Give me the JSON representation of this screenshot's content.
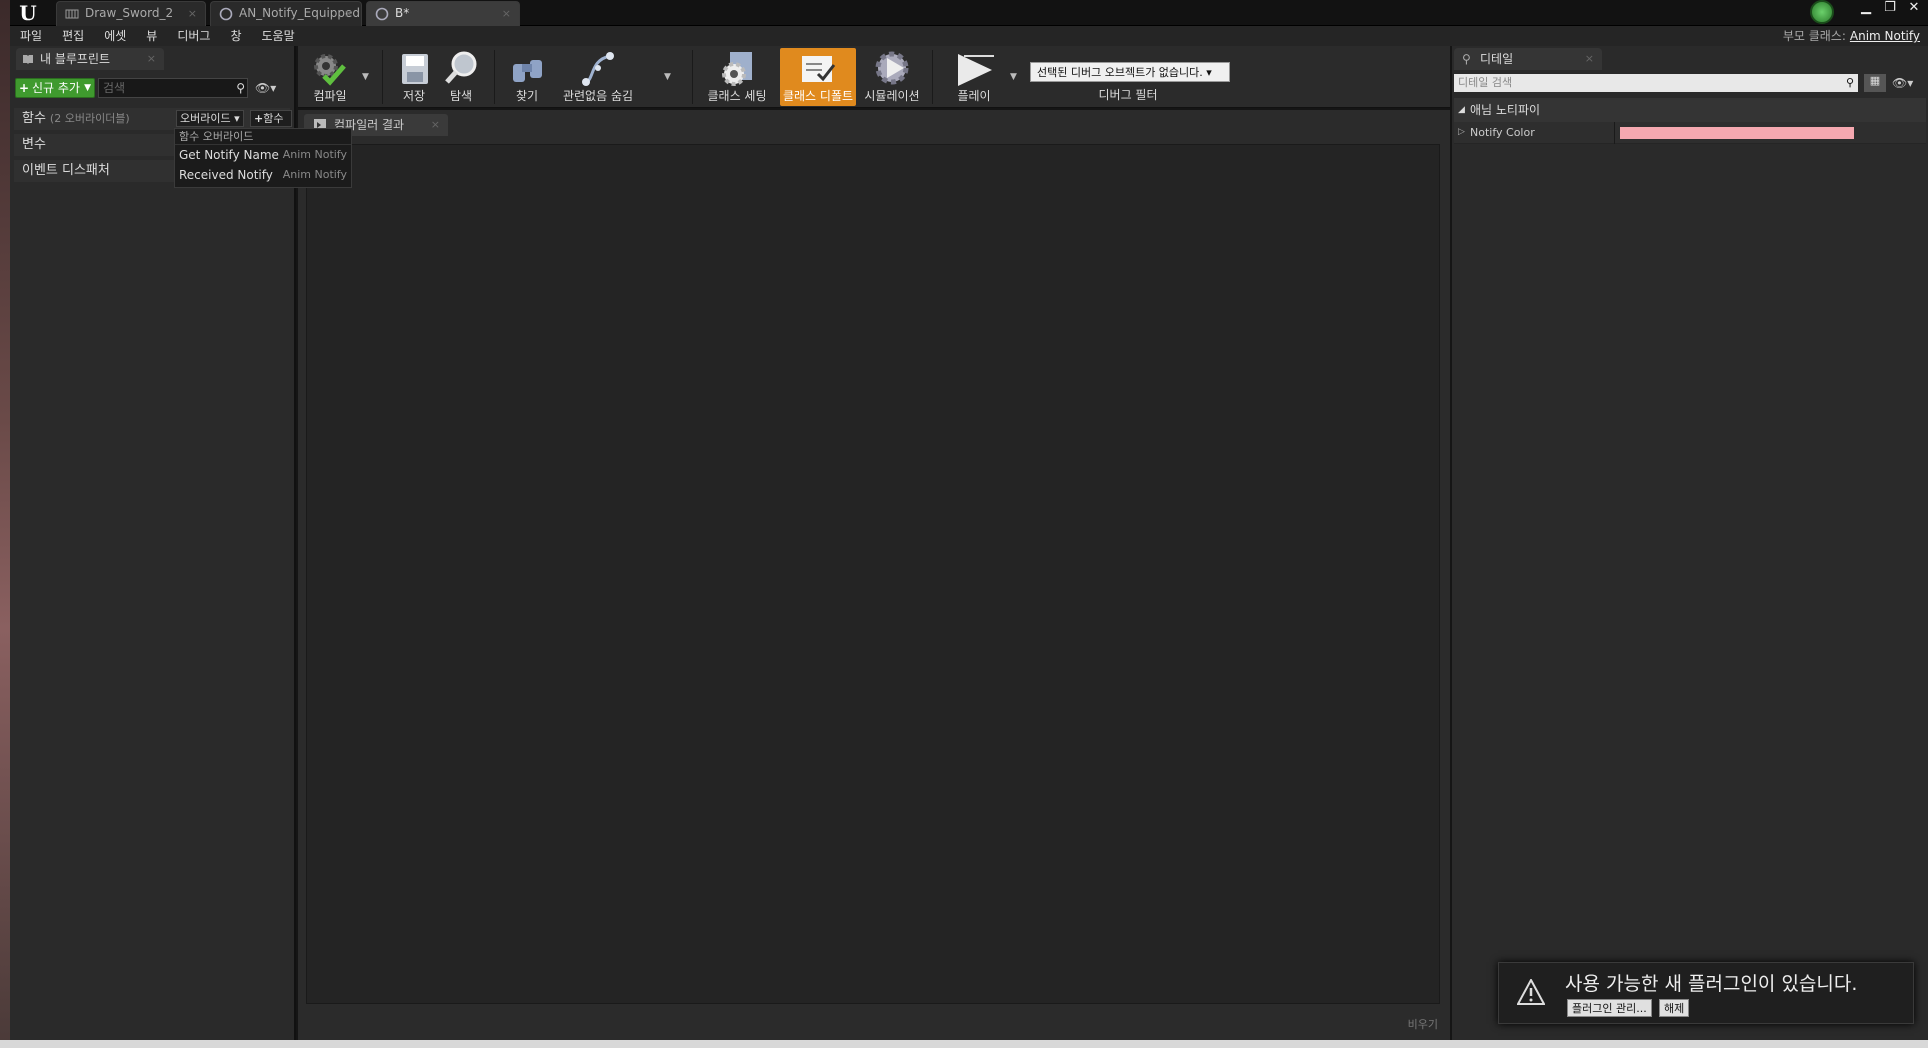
{
  "doc_tabs": [
    {
      "label": "Draw_Sword_2",
      "close": "×"
    },
    {
      "label": "AN_Notify_Equipped",
      "close": "×"
    },
    {
      "label": "B*",
      "close": "×"
    }
  ],
  "menu": [
    "파일",
    "편집",
    "에셋",
    "뷰",
    "디버그",
    "창",
    "도움말"
  ],
  "parent_class": {
    "label": "부모 클래스:",
    "value": "Anim Notify"
  },
  "my_blueprint": {
    "tab_label": "내 블루프린트",
    "add_new": "신규 추가",
    "search_placeholder": "검색",
    "functions": {
      "label": "함수",
      "count": "(2 오버라이더블)"
    },
    "override_button": "오버라이드",
    "add_function_button": "함수",
    "variables_label": "변수",
    "event_dispatchers_label": "이벤트 디스패처",
    "override_menu": {
      "header": "함수 오버라이드",
      "items": [
        {
          "name": "Get Notify Name",
          "owner": "Anim Notify"
        },
        {
          "name": "Received Notify",
          "owner": "Anim Notify"
        }
      ]
    }
  },
  "toolbar": {
    "compile": "컴파일",
    "save": "저장",
    "browse": "탐색",
    "find": "찾기",
    "hide_unrelated": "관련없음 숨김",
    "class_settings": "클래스 세팅",
    "class_defaults": "클래스 디폴트",
    "simulation": "시뮬레이션",
    "play": "플레이",
    "debug_select": "선택된 디버그 오브젝트가 없습니다.",
    "debug_filter": "디버그 필터"
  },
  "compiler": {
    "tab_label": "컴파일러 결과",
    "clear_button": "비우기"
  },
  "details": {
    "tab_label": "디테일",
    "search_placeholder": "디테일 검색",
    "category": "애님 노티파이",
    "property_name": "Notify Color",
    "property_color": "#f5a8b0"
  },
  "toast": {
    "message": "사용 가능한 새 플러그인이 있습니다.",
    "manage_button": "플러그인 관리...",
    "dismiss_button": "해제"
  },
  "colors": {
    "accent": "#e08a1e",
    "add_green": "#3f9a2e"
  }
}
